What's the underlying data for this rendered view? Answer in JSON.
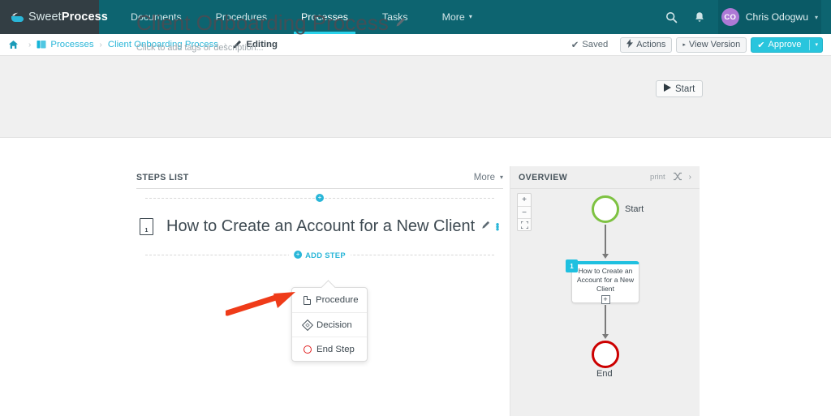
{
  "topnav": {
    "logo": {
      "light": "Sweet",
      "bold": "Process",
      "icon": "sweetprocess-cup-logo"
    },
    "items": [
      {
        "label": "Documents",
        "active": false
      },
      {
        "label": "Procedures",
        "active": false
      },
      {
        "label": "Processes",
        "active": true
      },
      {
        "label": "Tasks",
        "active": false
      },
      {
        "label": "More",
        "active": false,
        "caret": "▾"
      }
    ],
    "search_icon": "search-icon",
    "bell_icon": "bell-icon",
    "user": {
      "initials": "CO",
      "name": "Chris Odogwu",
      "caret": "▾"
    },
    "colors": {
      "bar": "#0d6470",
      "logo_bg": "#333e44",
      "active_underline": "#2ad2ea",
      "avatar": "#ad79d6"
    }
  },
  "breadcrumb": {
    "home_icon": "home-icon",
    "items": [
      {
        "label": "Processes",
        "icon": "stack-icon",
        "type": "link"
      },
      {
        "label": "Client Onboarding Process",
        "type": "link"
      },
      {
        "label": "Editing",
        "icon": "pencil-icon",
        "type": "current"
      }
    ],
    "separator": "›",
    "saved_label": "Saved",
    "saved_check": "✔",
    "actions_label": "Actions",
    "actions_icon": "bolt-icon",
    "view_version_label": "View Version",
    "view_version_icon": "▸",
    "approve_label": "Approve",
    "approve_check": "✔",
    "approve_caret": "▾"
  },
  "header": {
    "title": "Client Onboarding Process",
    "title_edit_icon": "pencil-icon",
    "subtitle": "Click to add tags or description...",
    "start_button": {
      "label": "Start",
      "icon": "play-icon"
    }
  },
  "steps_panel": {
    "title": "STEPS LIST",
    "more_label": "More",
    "more_caret": "▾",
    "add_top_icon": "plus-circle-icon",
    "add_step_label": "ADD STEP",
    "add_step_icon": "plus-circle-icon",
    "steps": [
      {
        "number": "1",
        "icon": "document-icon",
        "title": "How to Create an Account for a New Client",
        "edit_icon": "pencil-icon",
        "menu_icon": "kebab-menu-icon"
      }
    ]
  },
  "add_step_menu": {
    "items": [
      {
        "label": "Procedure",
        "icon": "page-icon"
      },
      {
        "label": "Decision",
        "icon": "diamond-icon"
      },
      {
        "label": "End Step",
        "icon": "circle-icon"
      }
    ]
  },
  "annotation": {
    "arrow": "red-arrow-pointing-to-procedure",
    "color": "#ef3b19"
  },
  "overview": {
    "title": "OVERVIEW",
    "print_label": "print",
    "shuffle_icon": "shuffle-icon",
    "collapse_icon": "chevron-right-icon",
    "zoom_controls": {
      "zoom_in": "+",
      "zoom_out": "−",
      "fit": "⬚"
    },
    "diagram": {
      "start_label": "Start",
      "end_label": "End",
      "node": {
        "badge": "1",
        "text": "How to Create an Account for a New Client",
        "expand_icon": "plus-box-icon"
      },
      "colors": {
        "start_ring": "#7ec242",
        "end_ring": "#cc0000",
        "node_accent": "#1fc0e0"
      }
    }
  }
}
